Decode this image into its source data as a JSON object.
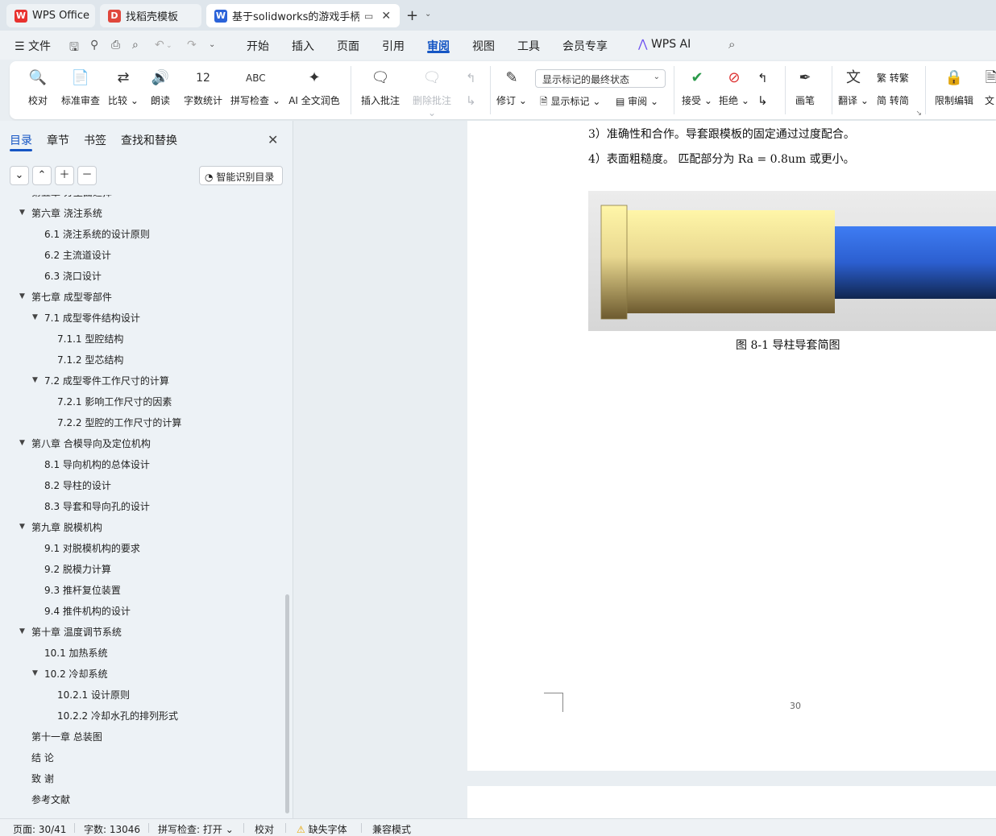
{
  "tabs": [
    {
      "label": "WPS Office",
      "logo": "W"
    },
    {
      "label": "找稻壳模板",
      "logo": "D"
    },
    {
      "label": "基于solidworks的游戏手柄方",
      "logo": "W"
    }
  ],
  "colors": {
    "accent": "#1656c4",
    "wps_red": "#e8322f",
    "doc_blue": "#2b63d9",
    "docer_red": "#e0473c"
  },
  "menu": {
    "file": "文件",
    "items": [
      "开始",
      "插入",
      "页面",
      "引用",
      "审阅",
      "视图",
      "工具",
      "会员专享",
      "WPS AI"
    ],
    "active": "审阅"
  },
  "ribbon": {
    "proofread": "校对",
    "std_review": "标准审查",
    "compare": "比较",
    "read_aloud": "朗读",
    "word_count": "字数统计",
    "spell_check": "拼写检查",
    "ai_polish": "AI 全文润色",
    "insert_comment": "插入批注",
    "delete_comment": "删除批注",
    "revise": "修订",
    "markup_state": "显示标记的最终状态",
    "show_markup": "显示标记",
    "review": "审阅",
    "accept": "接受",
    "reject": "拒绝",
    "pen": "画笔",
    "translate": "翻译",
    "to_traditional": "转繁",
    "to_simplified": "转简",
    "restrict_edit": "限制编辑",
    "doc_partial": "文"
  },
  "panel": {
    "tabs": [
      "目录",
      "章节",
      "书签",
      "查找和替换"
    ],
    "smart_toc": "智能识别目录",
    "toc": [
      {
        "text": "第五章 分型面选择",
        "level": 1,
        "caret": false
      },
      {
        "text": "第六章 浇注系统",
        "level": 1,
        "caret": true
      },
      {
        "text": "6.1 浇注系统的设计原则",
        "level": 2,
        "caret": false
      },
      {
        "text": "6.2 主流道设计",
        "level": 2,
        "caret": false
      },
      {
        "text": "6.3 浇口设计",
        "level": 2,
        "caret": false
      },
      {
        "text": "第七章 成型零部件",
        "level": 1,
        "caret": true
      },
      {
        "text": "7.1 成型零件结构设计",
        "level": 2,
        "caret": true
      },
      {
        "text": "7.1.1 型腔结构",
        "level": 3,
        "caret": false
      },
      {
        "text": "7.1.2 型芯结构",
        "level": 3,
        "caret": false
      },
      {
        "text": "7.2 成型零件工作尺寸的计算",
        "level": 2,
        "caret": true
      },
      {
        "text": "7.2.1 影响工作尺寸的因素",
        "level": 3,
        "caret": false
      },
      {
        "text": "7.2.2 型腔的工作尺寸的计算",
        "level": 3,
        "caret": false
      },
      {
        "text": "第八章 合模导向及定位机构",
        "level": 1,
        "caret": true
      },
      {
        "text": "8.1 导向机构的总体设计",
        "level": 2,
        "caret": false
      },
      {
        "text": "8.2 导柱的设计",
        "level": 2,
        "caret": false
      },
      {
        "text": "8.3 导套和导向孔的设计",
        "level": 2,
        "caret": false
      },
      {
        "text": "第九章 脱模机构",
        "level": 1,
        "caret": true
      },
      {
        "text": "9.1 对脱模机构的要求",
        "level": 2,
        "caret": false
      },
      {
        "text": "9.2 脱模力计算",
        "level": 2,
        "caret": false
      },
      {
        "text": "9.3 推杆复位装置",
        "level": 2,
        "caret": false
      },
      {
        "text": "9.4 推件机构的设计",
        "level": 2,
        "caret": false
      },
      {
        "text": "第十章 温度调节系统",
        "level": 1,
        "caret": true
      },
      {
        "text": "10.1 加热系统",
        "level": 2,
        "caret": false
      },
      {
        "text": "10.2 冷却系统",
        "level": 2,
        "caret": true
      },
      {
        "text": "10.2.1 设计原则",
        "level": 3,
        "caret": false
      },
      {
        "text": "10.2.2 冷却水孔的排列形式",
        "level": 3,
        "caret": false
      },
      {
        "text": "第十一章 总装图",
        "level": 1,
        "caret": false
      },
      {
        "text": "结 论",
        "level": 1,
        "caret": false
      },
      {
        "text": "致 谢",
        "level": 1,
        "caret": false
      },
      {
        "text": "参考文献",
        "level": 1,
        "caret": false
      }
    ]
  },
  "document": {
    "line1": "3）准确性和合作。导套跟模板的固定通过过度配合。",
    "line2": "4）表面粗糙度。 匹配部分为 Ra = 0.8um 或更小。",
    "caption": "图 8-1 导柱导套简图",
    "page_number": "30"
  },
  "status": {
    "page": "页面: 30/41",
    "words": "字数: 13046",
    "spell": "拼写检查: 打开",
    "proof": "校对",
    "missing_font": "缺失字体",
    "compat": "兼容模式"
  }
}
